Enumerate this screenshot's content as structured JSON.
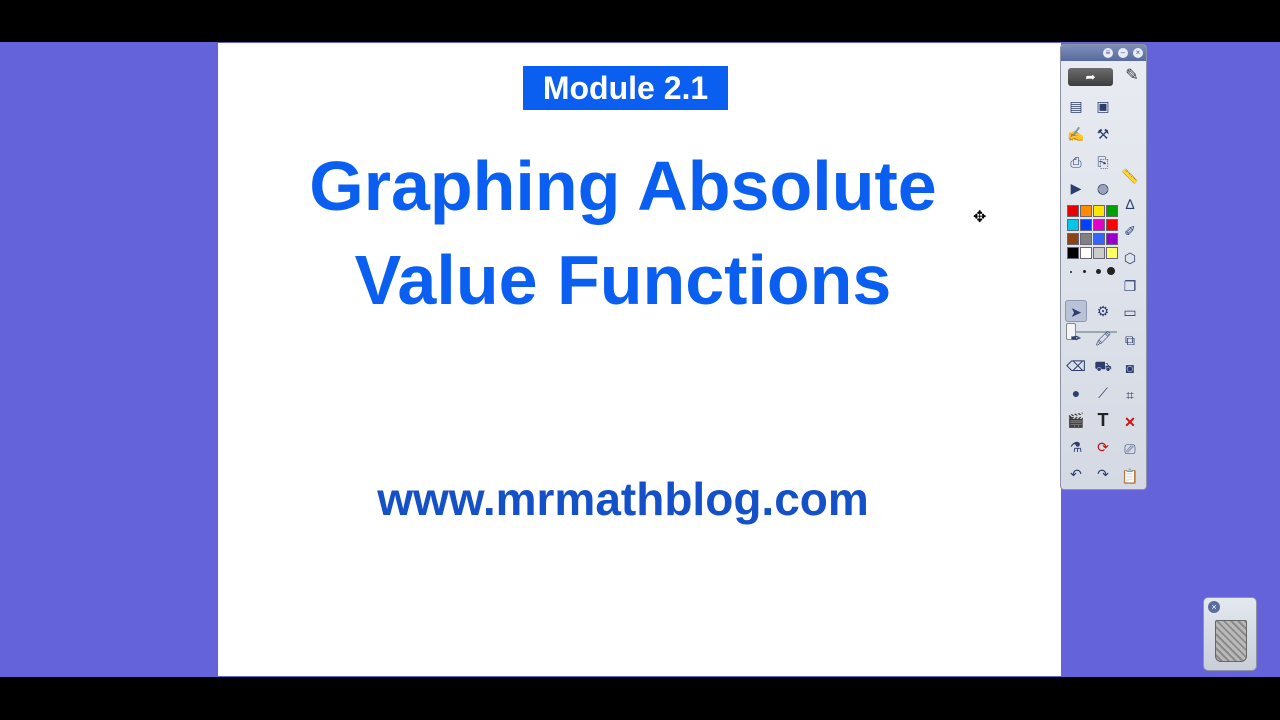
{
  "slide": {
    "module_label": "Module 2.1",
    "title_line1": "Graphing Absolute",
    "title_line2": "Value Functions",
    "url": "www.mrmathblog.com"
  },
  "toolbar": {
    "share_icon": "share-icon",
    "palette_colors": [
      "#e60000",
      "#ff8c00",
      "#ffe600",
      "#00a000",
      "#00c8e6",
      "#0040ff",
      "#e600c8",
      "#ff0000",
      "#8b4513",
      "#808080",
      "#3366ff",
      "#9900cc",
      "#000000",
      "#ffffff",
      "#cccccc",
      "#ffff66"
    ]
  },
  "trash": {
    "icon": "wastebasket-icon"
  }
}
